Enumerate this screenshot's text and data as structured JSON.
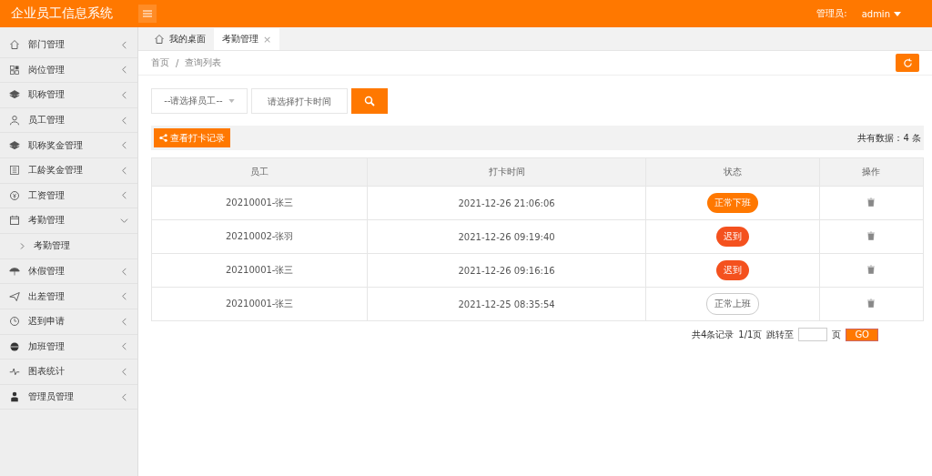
{
  "header": {
    "title": "企业员工信息系统",
    "user_label": "管理员:",
    "user_name": "admin"
  },
  "sidebar": {
    "items": [
      {
        "label": "部门管理",
        "expanded": false
      },
      {
        "label": "岗位管理",
        "expanded": false
      },
      {
        "label": "职称管理",
        "expanded": false
      },
      {
        "label": "员工管理",
        "expanded": false
      },
      {
        "label": "职称奖金管理",
        "expanded": false
      },
      {
        "label": "工龄奖金管理",
        "expanded": false
      },
      {
        "label": "工资管理",
        "expanded": false
      },
      {
        "label": "考勤管理",
        "expanded": true,
        "children": [
          {
            "label": "考勤管理"
          }
        ]
      },
      {
        "label": "休假管理",
        "expanded": false
      },
      {
        "label": "出差管理",
        "expanded": false
      },
      {
        "label": "迟到申请",
        "expanded": false
      },
      {
        "label": "加班管理",
        "expanded": false
      },
      {
        "label": "图表统计",
        "expanded": false
      },
      {
        "label": "管理员管理",
        "expanded": false
      }
    ]
  },
  "tabs": [
    {
      "label": "我的桌面",
      "selected": false
    },
    {
      "label": "考勤管理",
      "selected": true,
      "close": "×"
    }
  ],
  "breadcrumb": [
    "首页",
    "/",
    "查询列表"
  ],
  "filters": {
    "employee_select": {
      "placeholder": "--请选择员工--"
    },
    "time_field": {
      "placeholder": "请选择打卡时间"
    }
  },
  "toolbar": {
    "button": "查看打卡记录",
    "count": "共有数据：4 条"
  },
  "table": {
    "columns": [
      "员工",
      "打卡时间",
      "状态",
      "操作"
    ],
    "rows": [
      {
        "employee": "20210001-张三",
        "time": "2021-12-26 21:06:06",
        "status": {
          "label": "正常下班",
          "kind": "off-duty"
        }
      },
      {
        "employee": "20210002-张羽",
        "time": "2021-12-26 09:19:40",
        "status": {
          "label": "迟到",
          "kind": "late"
        }
      },
      {
        "employee": "20210001-张三",
        "time": "2021-12-26 09:16:16",
        "status": {
          "label": "迟到",
          "kind": "late"
        }
      },
      {
        "employee": "20210001-张三",
        "time": "2021-12-25 08:35:54",
        "status": {
          "label": "正常上班",
          "kind": "on-duty"
        }
      }
    ]
  },
  "pagination": {
    "summary": "共4条记录",
    "pages": "1/1页",
    "jump_label": "跳转至",
    "page_unit": "页",
    "go": "GO"
  }
}
